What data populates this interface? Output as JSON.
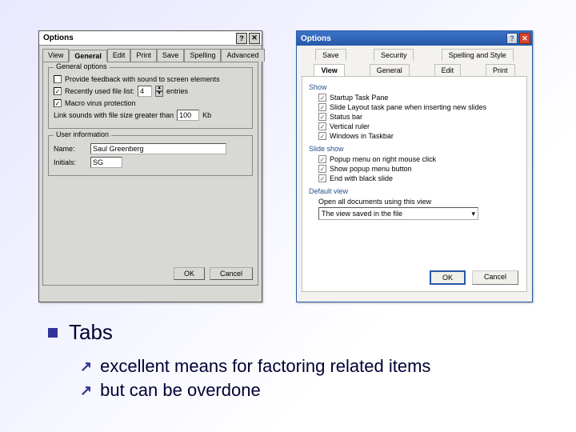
{
  "dialog1": {
    "title": "Options",
    "help_btn": "?",
    "close_btn": "✕",
    "tabs": [
      "View",
      "General",
      "Edit",
      "Print",
      "Save",
      "Spelling",
      "Advanced"
    ],
    "active_tab": "General",
    "group_general": {
      "legend": "General options",
      "feedback": "Provide feedback with sound to screen elements",
      "recent": "Recently used file list:",
      "recent_value": "4",
      "recent_suffix": "entries",
      "macro": "Macro virus protection",
      "link": "Link sounds with file size greater than",
      "link_value": "100",
      "link_suffix": "Kb"
    },
    "group_user": {
      "legend": "User information",
      "name_label": "Name:",
      "name_value": "Saul Greenberg",
      "initials_label": "Initials:",
      "initials_value": "SG"
    },
    "ok": "OK",
    "cancel": "Cancel"
  },
  "dialog2": {
    "title": "Options",
    "help_btn": "?",
    "close_btn": "✕",
    "tabs_top": [
      "Save",
      "Security",
      "Spelling and Style"
    ],
    "tabs_bot": [
      "View",
      "General",
      "Edit",
      "Print"
    ],
    "active_tab": "View",
    "sect_show": {
      "heading": "Show",
      "startup": "Startup Task Pane",
      "slide_layout": "Slide Layout task pane when inserting new slides",
      "status_bar": "Status bar",
      "vruler": "Vertical ruler",
      "windows_taskbar": "Windows in Taskbar"
    },
    "sect_slideshow": {
      "heading": "Slide show",
      "popup_rightclick": "Popup menu on right mouse click",
      "show_popup_btn": "Show popup menu button",
      "end_black": "End with black slide"
    },
    "sect_default": {
      "heading": "Default view",
      "open_all": "Open all documents using this view",
      "select_value": "The view saved in the file"
    },
    "ok": "OK",
    "cancel": "Cancel"
  },
  "bullets": {
    "heading": "Tabs",
    "sub1": "excellent means for factoring related items",
    "sub2": "but can be overdone"
  }
}
